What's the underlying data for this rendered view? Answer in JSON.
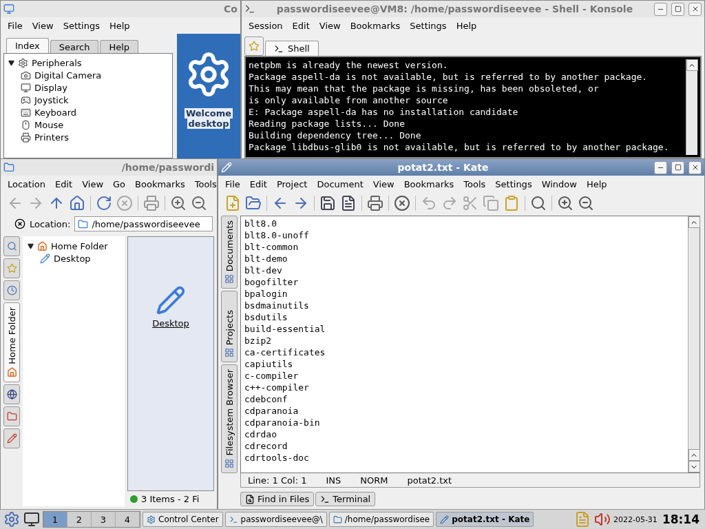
{
  "control_center": {
    "title": "Co",
    "menu": [
      "File",
      "View",
      "Settings",
      "Help"
    ],
    "tabs": [
      {
        "label": "Index",
        "selected": true
      },
      {
        "label": "Search",
        "selected": false
      },
      {
        "label": "Help",
        "selected": false
      }
    ],
    "tree": [
      {
        "label": "Peripherals",
        "expanded": true,
        "children": [
          {
            "label": "Digital Camera"
          },
          {
            "label": "Display"
          },
          {
            "label": "Joystick"
          },
          {
            "label": "Keyboard"
          },
          {
            "label": "Mouse"
          },
          {
            "label": "Printers"
          }
        ]
      }
    ],
    "welcome": [
      "Welcome",
      "desktop"
    ]
  },
  "konsole": {
    "title": "passwordiseevee@VM8: /home/passwordiseevee - Shell - Konsole",
    "menu": [
      "Session",
      "Edit",
      "View",
      "Bookmarks",
      "Settings",
      "Help"
    ],
    "tabs": [
      {
        "label": "Shell",
        "selected": true
      }
    ],
    "lines": [
      "netpbm is already the newest version.",
      "Package aspell-da is not available, but is referred to by another package.",
      "This may mean that the package is missing, has been obsoleted, or",
      "is only available from another source",
      "E: Package aspell-da has no installation candidate",
      "Reading package lists... Done",
      "Building dependency tree... Done",
      "Package libdbus-glib0 is not available, but is referred to by another package."
    ]
  },
  "konqueror": {
    "title": "/home/passwordi",
    "menu": [
      "Location",
      "Edit",
      "View",
      "Go",
      "Bookmarks",
      "Tools"
    ],
    "location_label": "Location:",
    "location": "/home/passwordiseevee",
    "sidebar_tabs": [
      {
        "kind": "icon",
        "selected": false
      },
      {
        "kind": "icon",
        "selected": false
      },
      {
        "kind": "icon",
        "selected": false
      },
      {
        "kind": "label",
        "label": "Home Folder",
        "selected": true
      },
      {
        "kind": "icon",
        "selected": false
      },
      {
        "kind": "icon",
        "selected": false
      },
      {
        "kind": "icon",
        "selected": false
      }
    ],
    "tree": [
      {
        "label": "Home Folder",
        "expanded": true,
        "children": [
          {
            "label": "Desktop"
          }
        ]
      }
    ],
    "icons": [
      {
        "label": "Desktop"
      }
    ],
    "status": "3 Items - 2 Fi"
  },
  "kate": {
    "title": "potat2.txt - Kate",
    "menu": [
      "File",
      "Edit",
      "Project",
      "Document",
      "View",
      "Bookmarks",
      "Tools",
      "Settings",
      "Window",
      "Help"
    ],
    "side_tabs": [
      {
        "label": "Documents",
        "selected": false
      },
      {
        "label": "Projects",
        "selected": false
      },
      {
        "label": "Filesystem Browser",
        "selected": false
      }
    ],
    "lines": [
      "blt8.0",
      "blt8.0-unoff",
      "blt-common",
      "blt-demo",
      "blt-dev",
      "bogofilter",
      "bpalogin",
      "bsdmainutils",
      "bsdutils",
      "build-essential",
      "bzip2",
      "ca-certificates",
      "capiutils",
      "c-compiler",
      "c++-compiler",
      "cdebconf",
      "cdparanoia",
      "cdparanoia-bin",
      "cdrdao",
      "cdrecord",
      "cdrtools-doc"
    ],
    "status": [
      "Line: 1 Col: 1",
      "INS",
      "NORM",
      "potat2.txt"
    ],
    "bottom_tabs": [
      {
        "label": "Find in Files",
        "selected": false
      },
      {
        "label": "Terminal",
        "selected": false
      }
    ]
  },
  "taskbar": {
    "desktops": [
      {
        "label": "1",
        "selected": true
      },
      {
        "label": "2",
        "selected": false
      },
      {
        "label": "3",
        "selected": false
      },
      {
        "label": "4",
        "selected": false
      }
    ],
    "tasks": [
      {
        "label": "Control Center",
        "selected": false
      },
      {
        "label": "passwordiseevee@\\",
        "selected": false
      },
      {
        "label": "/home/passwordisee",
        "selected": false
      },
      {
        "label": "potat2.txt - Kate",
        "selected": true
      }
    ],
    "date": "2022-05-31",
    "time": "18:14"
  }
}
